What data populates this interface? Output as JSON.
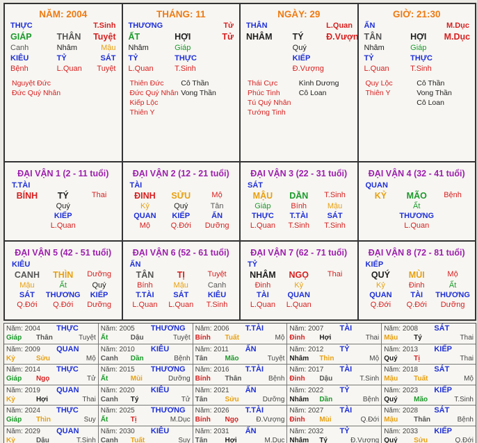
{
  "pillars": [
    {
      "header": "NĂM: 2004",
      "top": [
        "THỰC",
        "",
        "T.Sinh"
      ],
      "main": [
        "GIÁP",
        "THÂN",
        "Tuyệt"
      ],
      "hidden": [
        "Canh",
        "Nhâm",
        "Mậu"
      ],
      "gods": [
        "KIÊU",
        "TỶ",
        "SÁT"
      ],
      "status": [
        "Bệnh",
        "L.Quan",
        "Tuyệt"
      ],
      "notes_left": [
        "Nguyệt Đức",
        "Đức Quý Nhân"
      ],
      "notes_right": []
    },
    {
      "header": "THÁNG: 11",
      "top": [
        "THƯƠNG",
        "",
        "Tử"
      ],
      "main": [
        "ẤT",
        "HỢI",
        "Tử"
      ],
      "hidden": [
        "Nhâm",
        "Giáp",
        ""
      ],
      "gods": [
        "TỶ",
        "THỰC",
        ""
      ],
      "status": [
        "L.Quan",
        "T.Sinh",
        ""
      ],
      "notes_left": [
        "Thiên Đức",
        "Đức Quý Nhân",
        "Kiếp Lộc",
        "Thiên Y"
      ],
      "notes_right": [
        "Cô Thần",
        "Vong Thần"
      ]
    },
    {
      "header": "NGÀY: 29",
      "top": [
        "THÂN",
        "",
        "L.Quan"
      ],
      "main": [
        "NHÂM",
        "TÝ",
        "Đ.Vượng"
      ],
      "hidden": [
        "",
        "Quý",
        ""
      ],
      "gods": [
        "",
        "KIẾP",
        ""
      ],
      "status": [
        "",
        "Đ.Vượng",
        ""
      ],
      "notes_left": [
        "Thái Cực",
        "Phúc Tinh",
        "Tú Quý Nhân",
        "Tướng Tinh"
      ],
      "notes_right": [
        "Kình Dương",
        "Cô Loan"
      ]
    },
    {
      "header": "GIỜ: 21:30",
      "top": [
        "ẤN",
        "",
        "M.Dục"
      ],
      "main": [
        "TÂN",
        "HỢI",
        "M.Dục"
      ],
      "hidden": [
        "Nhâm",
        "Giáp",
        ""
      ],
      "gods": [
        "TỶ",
        "THỰC",
        ""
      ],
      "status": [
        "L.Quan",
        "T.Sinh",
        ""
      ],
      "notes_left": [
        "Quy Lộc",
        "Thiên Y"
      ],
      "notes_right": [
        "Cô Thần",
        "Vong Thần",
        "Cô Loan"
      ]
    }
  ],
  "dai_van": [
    {
      "header": "ĐẠI VẬN 1 (2 - 11 tuổi)",
      "top": "T.TÀI",
      "main": [
        "BÍNH",
        "TÝ",
        "Thai"
      ],
      "hidden": [
        "",
        "Quý",
        ""
      ],
      "gods": [
        "",
        "KIẾP",
        ""
      ],
      "status": [
        "",
        "L.Quan",
        ""
      ]
    },
    {
      "header": "ĐẠI VẬN 2 (12 - 21 tuổi)",
      "top": "TÀI",
      "main": [
        "ĐINH",
        "SỬU",
        "Mộ"
      ],
      "hidden": [
        "Kỷ",
        "Quý",
        "Tân"
      ],
      "gods": [
        "QUAN",
        "KIẾP",
        "ẤN"
      ],
      "status": [
        "Mộ",
        "Q.Đới",
        "Dưỡng"
      ]
    },
    {
      "header": "ĐẠI VẬN 3 (22 - 31 tuổi)",
      "top": "SÁT",
      "main": [
        "MẬU",
        "DẦN",
        "T.Sinh"
      ],
      "hidden": [
        "Giáp",
        "Bính",
        "Mậu"
      ],
      "gods": [
        "THỰC",
        "T.TÀI",
        "SÁT"
      ],
      "status": [
        "L.Quan",
        "T.Sinh",
        "T.Sinh"
      ]
    },
    {
      "header": "ĐẠI VẬN 4 (32 - 41 tuổi)",
      "top": "QUAN",
      "main": [
        "KỶ",
        "MÃO",
        "Bệnh"
      ],
      "hidden": [
        "",
        "Ất",
        ""
      ],
      "gods": [
        "",
        "THƯƠNG",
        ""
      ],
      "status": [
        "",
        "L.Quan",
        ""
      ]
    },
    {
      "header": "ĐẠI VẬN 5 (42 - 51 tuổi)",
      "top": "KIÊU",
      "main": [
        "CANH",
        "THÌN",
        "Dưỡng"
      ],
      "hidden": [
        "Mậu",
        "Ất",
        "Quý"
      ],
      "gods": [
        "SÁT",
        "THƯƠNG",
        "KIẾP"
      ],
      "status": [
        "Q.Đới",
        "Q.Đới",
        "Dưỡng"
      ]
    },
    {
      "header": "ĐẠI VẬN 6 (52 - 61 tuổi)",
      "top": "ẤN",
      "main": [
        "TÂN",
        "TỊ",
        "Tuyệt"
      ],
      "hidden": [
        "Bính",
        "Mậu",
        "Canh"
      ],
      "gods": [
        "T.TÀI",
        "SÁT",
        "KIÊU"
      ],
      "status": [
        "L.Quan",
        "L.Quan",
        "T.Sinh"
      ]
    },
    {
      "header": "ĐẠI VẬN 7 (62 - 71 tuổi)",
      "top": "TỶ",
      "main": [
        "NHÂM",
        "NGỌ",
        "Thai"
      ],
      "hidden": [
        "Đinh",
        "Kỷ",
        ""
      ],
      "gods": [
        "TÀI",
        "QUAN",
        ""
      ],
      "status": [
        "L.Quan",
        "L.Quan",
        ""
      ]
    },
    {
      "header": "ĐẠI VẬN 8 (72 - 81 tuổi)",
      "top": "KIẾP",
      "main": [
        "QUÝ",
        "MÙI",
        "Mộ"
      ],
      "hidden": [
        "Kỷ",
        "Đinh",
        "Ất"
      ],
      "gods": [
        "QUAN",
        "TÀI",
        "THƯƠNG"
      ],
      "status": [
        "Q.Đới",
        "Q.Đới",
        "Dưỡng"
      ]
    }
  ],
  "years": [
    [
      {
        "year": "Năm: 2004",
        "god": "THỰC",
        "can": "Giáp",
        "chi": "Thân",
        "stage": "Tuyệt"
      },
      {
        "year": "Năm: 2005",
        "god": "THƯƠNG",
        "can": "Ất",
        "chi": "Dậu",
        "stage": "Tuyệt"
      },
      {
        "year": "Năm: 2006",
        "god": "T.TÀI",
        "can": "Bính",
        "chi": "Tuất",
        "stage": "Mộ"
      },
      {
        "year": "Năm: 2007",
        "god": "TÀI",
        "can": "Đinh",
        "chi": "Hợi",
        "stage": "Thai"
      },
      {
        "year": "Năm: 2008",
        "god": "SÁT",
        "can": "Mậu",
        "chi": "Tý",
        "stage": "Thai"
      }
    ],
    [
      {
        "year": "Năm: 2009",
        "god": "QUAN",
        "can": "Kỷ",
        "chi": "Sửu",
        "stage": "Mộ"
      },
      {
        "year": "Năm: 2010",
        "god": "KIÊU",
        "can": "Canh",
        "chi": "Dần",
        "stage": "Bệnh"
      },
      {
        "year": "Năm: 2011",
        "god": "ẤN",
        "can": "Tân",
        "chi": "Mão",
        "stage": "Tuyệt"
      },
      {
        "year": "Năm: 2012",
        "god": "TỶ",
        "can": "Nhâm",
        "chi": "Thìn",
        "stage": "Mộ"
      },
      {
        "year": "Năm: 2013",
        "god": "KIẾP",
        "can": "Quý",
        "chi": "Tị",
        "stage": "Thai"
      }
    ],
    [
      {
        "year": "Năm: 2014",
        "god": "THỰC",
        "can": "Giáp",
        "chi": "Ngọ",
        "stage": "Tử"
      },
      {
        "year": "Năm: 2015",
        "god": "THƯƠNG",
        "can": "Ất",
        "chi": "Mùi",
        "stage": "Dưỡng"
      },
      {
        "year": "Năm: 2016",
        "god": "T.TÀI",
        "can": "Bính",
        "chi": "Thân",
        "stage": "Bệnh"
      },
      {
        "year": "Năm: 2017",
        "god": "TÀI",
        "can": "Đinh",
        "chi": "Dậu",
        "stage": "T.Sinh"
      },
      {
        "year": "Năm: 2018",
        "god": "SÁT",
        "can": "Mậu",
        "chi": "Tuất",
        "stage": "Mộ"
      }
    ],
    [
      {
        "year": "Năm: 2019",
        "god": "QUAN",
        "can": "Kỷ",
        "chi": "Hợi",
        "stage": "Thai"
      },
      {
        "year": "Năm: 2020",
        "god": "KIÊU",
        "can": "Canh",
        "chi": "Tý",
        "stage": "Tử"
      },
      {
        "year": "Năm: 2021",
        "god": "ẤN",
        "can": "Tân",
        "chi": "Sửu",
        "stage": "Dưỡng"
      },
      {
        "year": "Năm: 2022",
        "god": "TỶ",
        "can": "Nhâm",
        "chi": "Dần",
        "stage": "Bệnh"
      },
      {
        "year": "Năm: 2023",
        "god": "KIẾP",
        "can": "Quý",
        "chi": "Mão",
        "stage": "T.Sinh"
      }
    ],
    [
      {
        "year": "Năm: 2024",
        "god": "THỰC",
        "can": "Giáp",
        "chi": "Thìn",
        "stage": "Suy"
      },
      {
        "year": "Năm: 2025",
        "god": "THƯƠNG",
        "can": "Ất",
        "chi": "Tị",
        "stage": "M.Dục"
      },
      {
        "year": "Năm: 2026",
        "god": "T.TÀI",
        "can": "Bính",
        "chi": "Ngọ",
        "stage": "Đ.Vượng"
      },
      {
        "year": "Năm: 2027",
        "god": "TÀI",
        "can": "Đinh",
        "chi": "Mùi",
        "stage": "Q.Đới"
      },
      {
        "year": "Năm: 2028",
        "god": "SÁT",
        "can": "Mậu",
        "chi": "Thân",
        "stage": "Bệnh"
      }
    ],
    [
      {
        "year": "Năm: 2029",
        "god": "QUAN",
        "can": "Kỷ",
        "chi": "Dậu",
        "stage": "T.Sinh"
      },
      {
        "year": "Năm: 2030",
        "god": "KIÊU",
        "can": "Canh",
        "chi": "Tuất",
        "stage": "Suy"
      },
      {
        "year": "Năm: 2031",
        "god": "ẤN",
        "can": "Tân",
        "chi": "Hợi",
        "stage": "M.Dục"
      },
      {
        "year": "Năm: 2032",
        "god": "TỶ",
        "can": "Nhâm",
        "chi": "Tý",
        "stage": "Đ.Vượng"
      },
      {
        "year": "Năm: 2033",
        "god": "KIẾP",
        "can": "Quý",
        "chi": "Sửu",
        "stage": "Q.Đới"
      }
    ]
  ],
  "colors": {
    "god": "#1e2fd6",
    "stage": "#d62020",
    "header_pillar": "#ee7a12",
    "header_daivan": "#9d1fae",
    "wood": "#1a9a2a",
    "fire": "#d62020",
    "earth": "#e8a010",
    "metal": "#555555",
    "water": "#202020"
  }
}
